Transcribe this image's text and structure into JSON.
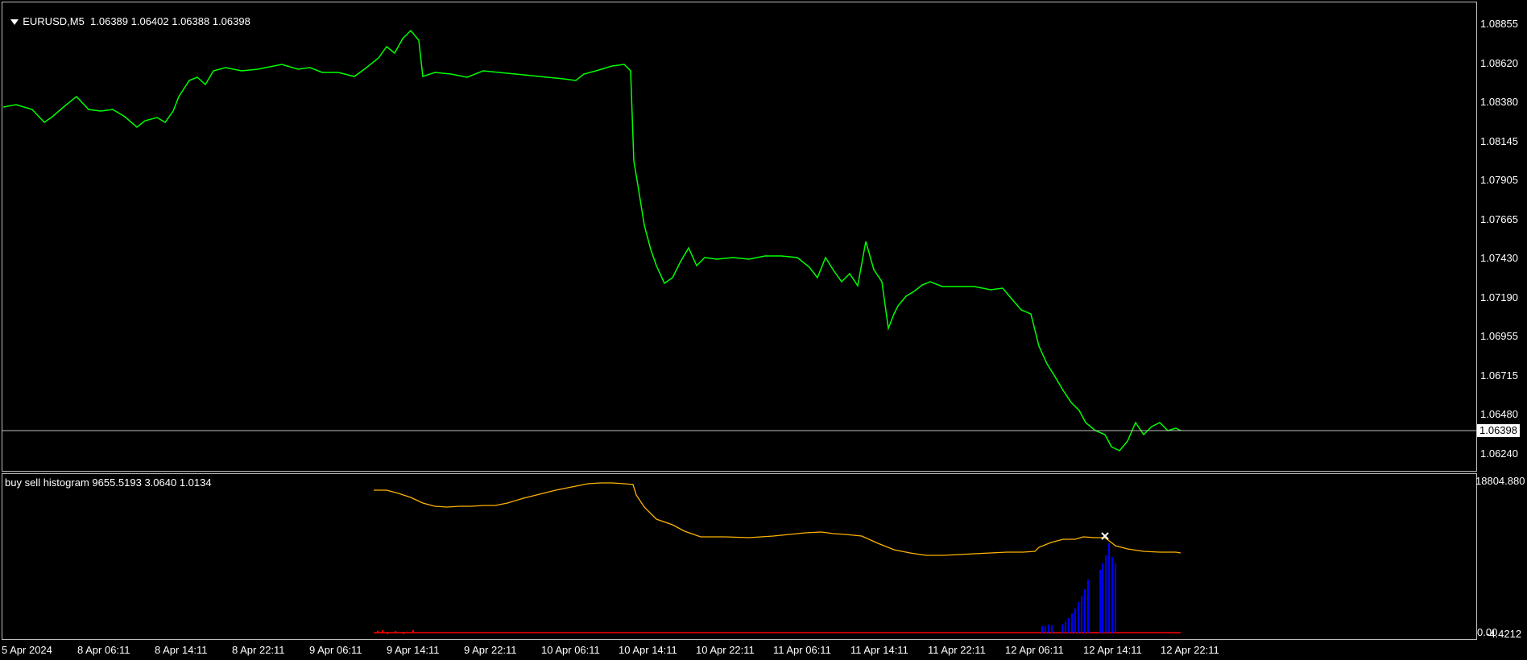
{
  "main": {
    "title": "EURUSD,M5  1.06389 1.06402 1.06388 1.06398",
    "current_price": "1.06398",
    "price_labels": [
      "1.08855",
      "1.08620",
      "1.08380",
      "1.08145",
      "1.07905",
      "1.07665",
      "1.07430",
      "1.07190",
      "1.06955",
      "1.06715",
      "1.06480",
      "1.06240"
    ],
    "line_color": "#00ff00"
  },
  "indicator": {
    "title": "buy sell histogram 9655.5193 3.0640 1.0134",
    "top_label": "18804.880",
    "bottom_label_a": "0.00",
    "bottom_label_b": "-4.4212",
    "line_color": "#ffb400",
    "histogram_color": "#0000ff",
    "zero_line_color": "#ff0000"
  },
  "time_axis": [
    "5 Apr 2024",
    "8 Apr 06:11",
    "8 Apr 14:11",
    "8 Apr 22:11",
    "9 Apr 06:11",
    "9 Apr 14:11",
    "9 Apr 22:11",
    "10 Apr 06:11",
    "10 Apr 14:11",
    "10 Apr 22:11",
    "11 Apr 06:11",
    "11 Apr 14:11",
    "11 Apr 22:11",
    "12 Apr 06:11",
    "12 Apr 14:11",
    "12 Apr 22:11"
  ],
  "chart_data": [
    {
      "type": "line",
      "title": "EURUSD,M5  1.06389 1.06402 1.06388 1.06398",
      "xlabel": "",
      "ylabel": "",
      "x": [
        "5 Apr 2024",
        "8 Apr 06:11",
        "8 Apr 14:11",
        "8 Apr 22:11",
        "9 Apr 06:11",
        "9 Apr 14:11",
        "9 Apr 22:11",
        "10 Apr 06:11",
        "10 Apr 14:11",
        "10 Apr 22:11",
        "11 Apr 06:11",
        "11 Apr 14:11",
        "11 Apr 22:11",
        "12 Apr 06:11",
        "12 Apr 14:11",
        "12 Apr 22:11"
      ],
      "series": [
        {
          "values": [
            1.0837,
            1.0838,
            1.0833,
            1.086,
            1.0858,
            1.087,
            1.086,
            1.086,
            1.0861,
            1.0744,
            1.0743,
            1.073,
            1.0725,
            1.0715,
            1.064,
            1.064
          ]
        }
      ],
      "ylim": [
        1.062,
        1.089
      ],
      "grid": false,
      "current_value": 1.06398
    },
    {
      "type": "line",
      "title": "buy sell histogram 9655.5193 3.0640 1.0134",
      "xlabel": "",
      "ylabel": "",
      "x": [
        "9 Apr 06:11",
        "9 Apr 14:11",
        "9 Apr 22:11",
        "10 Apr 06:11",
        "10 Apr 14:11",
        "10 Apr 22:11",
        "11 Apr 06:11",
        "11 Apr 14:11",
        "11 Apr 22:11",
        "12 Apr 06:11",
        "12 Apr 14:11",
        "12 Apr 22:11"
      ],
      "series": [
        {
          "values": [
            17600,
            16300,
            16500,
            17900,
            18800,
            14000,
            14000,
            14300,
            12800,
            13000,
            14300,
            13200
          ]
        }
      ],
      "histogram": {
        "x": [
          "12 Apr 06:11",
          "12 Apr 06:11",
          "12 Apr 06:11",
          "12 Apr 14:11",
          "12 Apr 14:11",
          "12 Apr 14:11",
          "12 Apr 14:11"
        ],
        "values": [
          600,
          1500,
          3500,
          8000,
          11000,
          14000,
          12500
        ]
      },
      "ylim": [
        -4.4212,
        18804.88
      ],
      "grid": false
    }
  ]
}
